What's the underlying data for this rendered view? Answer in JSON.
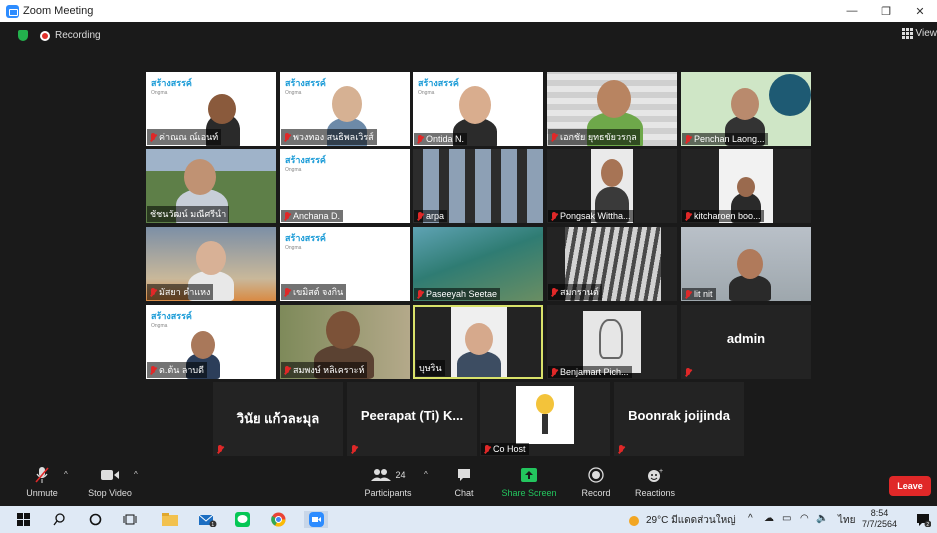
{
  "window": {
    "title": "Zoom Meeting"
  },
  "top": {
    "recording_label": "Recording",
    "view_label": "View"
  },
  "tiles": [
    {
      "name": "ค่าณณ ณ์เอนท์",
      "logo": "สร้างสรรค์"
    },
    {
      "name": "พวงทอง สนธิพลเวิรส์",
      "logo": "สร้างสรรค์"
    },
    {
      "name": "Ontida N.",
      "logo": "สร้างสรรค์"
    },
    {
      "name": "เอกชัย ยุทธขัยวรกุล"
    },
    {
      "name": "Penchan Laong..."
    },
    {
      "name": "ชัชนวัฒน์ มณีศรีนำ"
    },
    {
      "name": "Anchana D.",
      "logo": "สร้างสรรค์"
    },
    {
      "name": "arpa"
    },
    {
      "name": "Pongsak Wittha..."
    },
    {
      "name": "kitcharoen boo..."
    },
    {
      "name": "มัสยา คำแหง"
    },
    {
      "name": "เขมิสต์ จงกิน",
      "logo": "สร้างสรรค์"
    },
    {
      "name": "Paseeyah Seetae"
    },
    {
      "name": "สมกรานต์"
    },
    {
      "name": "lit nit"
    },
    {
      "name": "ด.ต้น ลาบดี",
      "logo": "สร้างสรรค์"
    },
    {
      "name": "สมพงษ์ หลิเคราะห์"
    },
    {
      "name": "บุษริน"
    },
    {
      "name": "Benjamart Pich..."
    },
    {
      "name": "admin"
    },
    {
      "name": "วินัย แก้วละมุล"
    },
    {
      "name": "Peerapat (Ti) K..."
    },
    {
      "name": "Co Host"
    },
    {
      "name": "Boonrak joijinda"
    }
  ],
  "toolbar": {
    "unmute": "Unmute",
    "stop_video": "Stop Video",
    "participants": "Participants",
    "participants_count": "24",
    "chat": "Chat",
    "share_screen": "Share Screen",
    "record": "Record",
    "reactions": "Reactions",
    "leave": "Leave"
  },
  "taskbar": {
    "weather": "29°C มีแดดส่วนใหญ่",
    "lang": "ไทย",
    "time": "8:54",
    "date": "7/7/2564",
    "notif_count": "2",
    "mail_badge": "1"
  }
}
